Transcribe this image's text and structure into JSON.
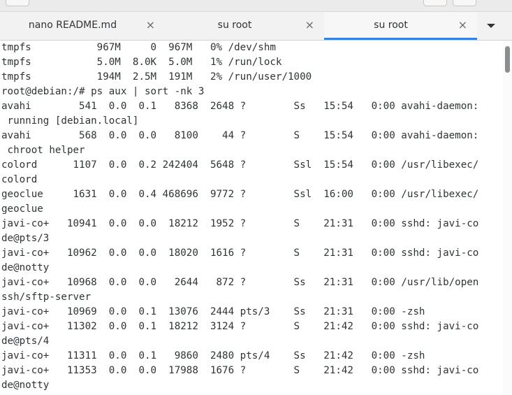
{
  "tabs": [
    {
      "label": "nano README.md",
      "active": false
    },
    {
      "label": "su root",
      "active": false
    },
    {
      "label": "su root",
      "active": true
    }
  ],
  "icons": {
    "tab_close": "×",
    "tab_menu": "chevron-down-icon",
    "header_menu": "hamburger-menu-icon"
  },
  "colors": {
    "active_tab_underline": "#3584e4",
    "terminal_text": "#2e3436",
    "terminal_background": "#ffffff"
  },
  "terminal": {
    "lines": [
      "tmpfs           967M     0  967M   0% /dev/shm",
      "tmpfs           5.0M  8.0K  5.0M   1% /run/lock",
      "tmpfs           194M  2.5M  191M   2% /run/user/1000",
      "root@debian:/# ps aux | sort -nk 3",
      "avahi        541  0.0  0.1   8368  2648 ?        Ss   15:54   0:00 avahi-daemon:",
      " running [debian.local]",
      "avahi        568  0.0  0.0   8100    44 ?        S    15:54   0:00 avahi-daemon:",
      " chroot helper",
      "colord      1107  0.0  0.2 242404  5648 ?        Ssl  15:54   0:00 /usr/libexec/",
      "colord",
      "geoclue     1631  0.0  0.4 468696  9772 ?        Ssl  16:00   0:00 /usr/libexec/",
      "geoclue",
      "javi-co+   10941  0.0  0.0  18212  1952 ?        S    21:31   0:00 sshd: javi-co",
      "de@pts/3",
      "javi-co+   10962  0.0  0.0  18020  1616 ?        S    21:31   0:00 sshd: javi-co",
      "de@notty",
      "javi-co+   10968  0.0  0.0   2644   872 ?        Ss   21:31   0:00 /usr/lib/open",
      "ssh/sftp-server",
      "javi-co+   10969  0.0  0.1  13076  2444 pts/3    Ss   21:31   0:00 -zsh",
      "javi-co+   11302  0.0  0.1  18212  3124 ?        S    21:42   0:00 sshd: javi-co",
      "de@pts/4",
      "javi-co+   11311  0.0  0.1   9860  2480 pts/4    Ss   21:42   0:00 -zsh",
      "javi-co+   11353  0.0  0.0  17988  1676 ?        S    21:42   0:00 sshd: javi-co",
      "de@notty"
    ]
  }
}
